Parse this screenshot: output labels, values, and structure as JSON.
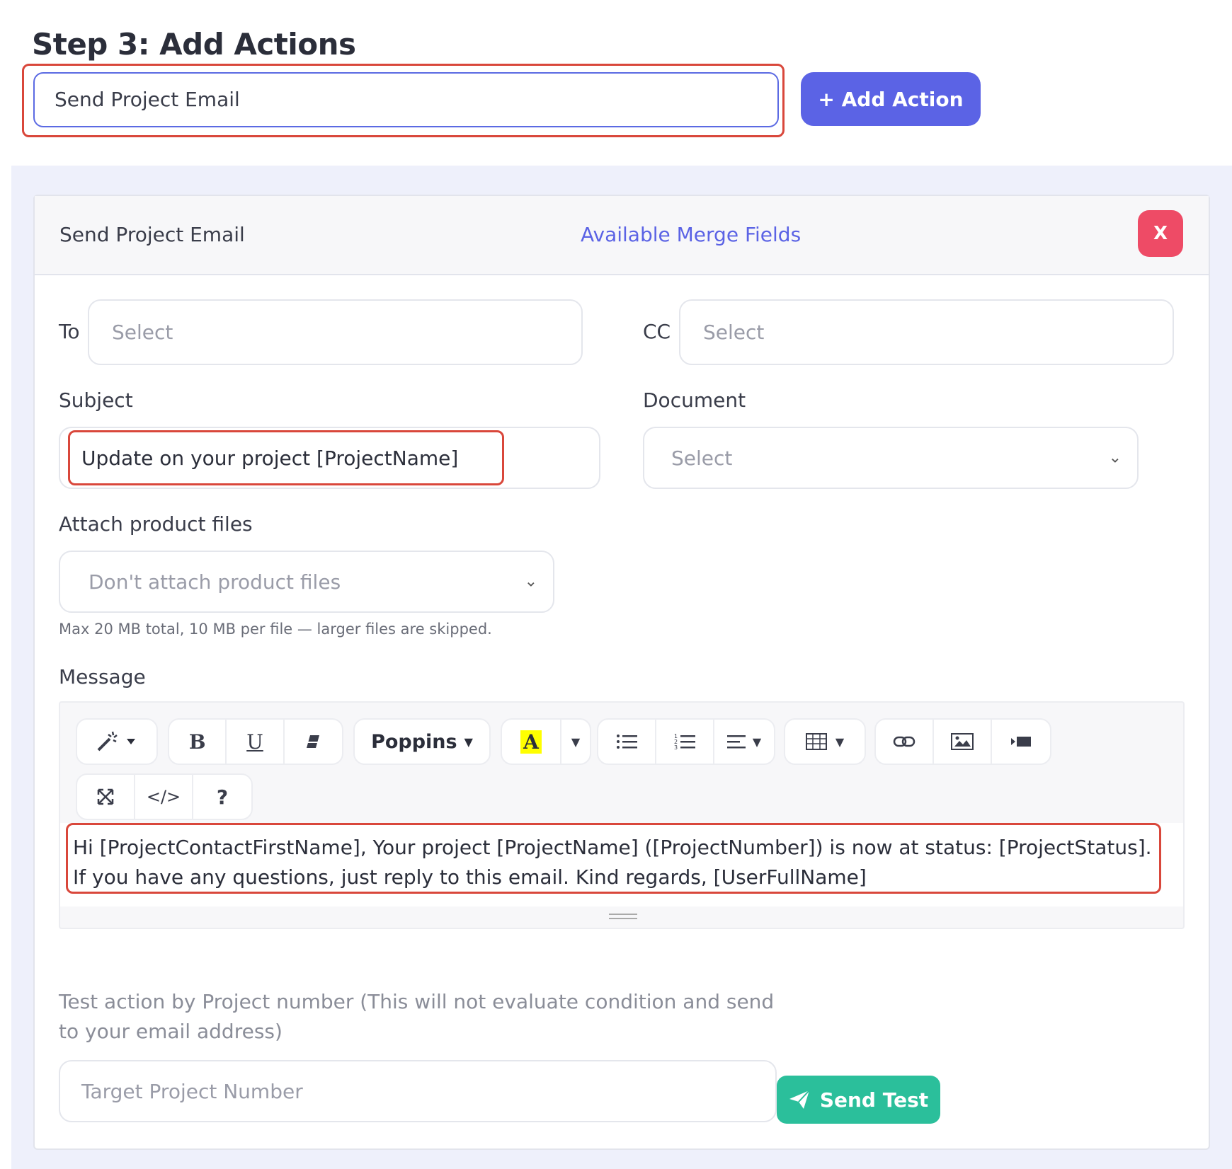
{
  "step_title": "Step 3: Add Actions",
  "action_select": {
    "value": "Send Project Email"
  },
  "add_action_label": "+ Add Action",
  "card": {
    "title": "Send Project Email",
    "merge_fields_link": "Available Merge Fields",
    "close_label": "X"
  },
  "to": {
    "label": "To",
    "placeholder": "Select"
  },
  "cc": {
    "label": "CC",
    "placeholder": "Select"
  },
  "subject": {
    "label": "Subject",
    "value": "Update on your project [ProjectName]"
  },
  "document": {
    "label": "Document",
    "placeholder": "Select"
  },
  "attach": {
    "label": "Attach product files",
    "value": "Don't attach product files",
    "hint": "Max 20 MB total, 10 MB per file — larger files are skipped."
  },
  "message": {
    "label": "Message",
    "font_name": "Poppins",
    "body": "Hi [ProjectContactFirstName], Your project [ProjectName] ([ProjectNumber]) is now at status: [ProjectStatus]. If you have any questions, just reply to this email. Kind regards, [UserFullName]"
  },
  "test": {
    "label": "Test action by Project number (This will not evaluate condition and send to your email address)",
    "placeholder": "Target Project Number",
    "button_label": "Send Test"
  },
  "colors": {
    "primary": "#5b63e5",
    "danger": "#ee4b66",
    "success": "#2bbf9b",
    "highlight_box": "#d9473b",
    "panel_bg": "#eef0fb"
  }
}
